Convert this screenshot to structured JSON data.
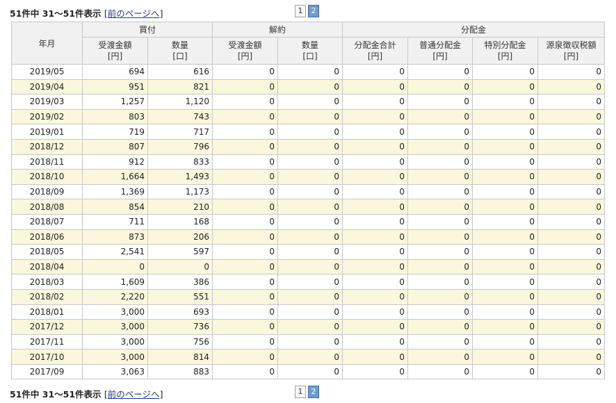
{
  "pager": {
    "summary": "51件中 31～51件表示",
    "bracket_open": "[",
    "prev_label": "前のページへ",
    "bracket_close": "]",
    "pages": [
      "1",
      "2"
    ],
    "current_page": "2"
  },
  "table": {
    "month_header": "年月",
    "groups": {
      "buy": "買付",
      "cancel": "解約",
      "dist": "分配金"
    },
    "columns": [
      {
        "name": "受渡金額",
        "unit": "[円]"
      },
      {
        "name": "数量",
        "unit": "[口]"
      },
      {
        "name": "受渡金額",
        "unit": "[円]"
      },
      {
        "name": "数量",
        "unit": "[口]"
      },
      {
        "name": "分配金合計",
        "unit": "[円]"
      },
      {
        "name": "普通分配金",
        "unit": "[円]"
      },
      {
        "name": "特別分配金",
        "unit": "[円]"
      },
      {
        "name": "源泉徴収税額",
        "unit": "[円]"
      }
    ],
    "rows": [
      [
        "2019/05",
        "694",
        "616",
        "0",
        "0",
        "0",
        "0",
        "0",
        "0"
      ],
      [
        "2019/04",
        "951",
        "821",
        "0",
        "0",
        "0",
        "0",
        "0",
        "0"
      ],
      [
        "2019/03",
        "1,257",
        "1,120",
        "0",
        "0",
        "0",
        "0",
        "0",
        "0"
      ],
      [
        "2019/02",
        "803",
        "743",
        "0",
        "0",
        "0",
        "0",
        "0",
        "0"
      ],
      [
        "2019/01",
        "719",
        "717",
        "0",
        "0",
        "0",
        "0",
        "0",
        "0"
      ],
      [
        "2018/12",
        "807",
        "796",
        "0",
        "0",
        "0",
        "0",
        "0",
        "0"
      ],
      [
        "2018/11",
        "912",
        "833",
        "0",
        "0",
        "0",
        "0",
        "0",
        "0"
      ],
      [
        "2018/10",
        "1,664",
        "1,493",
        "0",
        "0",
        "0",
        "0",
        "0",
        "0"
      ],
      [
        "2018/09",
        "1,369",
        "1,173",
        "0",
        "0",
        "0",
        "0",
        "0",
        "0"
      ],
      [
        "2018/08",
        "854",
        "210",
        "0",
        "0",
        "0",
        "0",
        "0",
        "0"
      ],
      [
        "2018/07",
        "711",
        "168",
        "0",
        "0",
        "0",
        "0",
        "0",
        "0"
      ],
      [
        "2018/06",
        "873",
        "206",
        "0",
        "0",
        "0",
        "0",
        "0",
        "0"
      ],
      [
        "2018/05",
        "2,541",
        "597",
        "0",
        "0",
        "0",
        "0",
        "0",
        "0"
      ],
      [
        "2018/04",
        "0",
        "0",
        "0",
        "0",
        "0",
        "0",
        "0",
        "0"
      ],
      [
        "2018/03",
        "1,609",
        "386",
        "0",
        "0",
        "0",
        "0",
        "0",
        "0"
      ],
      [
        "2018/02",
        "2,220",
        "551",
        "0",
        "0",
        "0",
        "0",
        "0",
        "0"
      ],
      [
        "2018/01",
        "3,000",
        "693",
        "0",
        "0",
        "0",
        "0",
        "0",
        "0"
      ],
      [
        "2017/12",
        "3,000",
        "736",
        "0",
        "0",
        "0",
        "0",
        "0",
        "0"
      ],
      [
        "2017/11",
        "3,000",
        "756",
        "0",
        "0",
        "0",
        "0",
        "0",
        "0"
      ],
      [
        "2017/10",
        "3,000",
        "814",
        "0",
        "0",
        "0",
        "0",
        "0",
        "0"
      ],
      [
        "2017/09",
        "3,063",
        "883",
        "0",
        "0",
        "0",
        "0",
        "0",
        "0"
      ]
    ]
  },
  "colors": {
    "header_bg": "#f1f1f1",
    "alt_row_bg": "#fbf7dc",
    "border": "#c7c7c7",
    "link": "#1a3c8c",
    "current_page_bg": "#6d9bd1"
  }
}
